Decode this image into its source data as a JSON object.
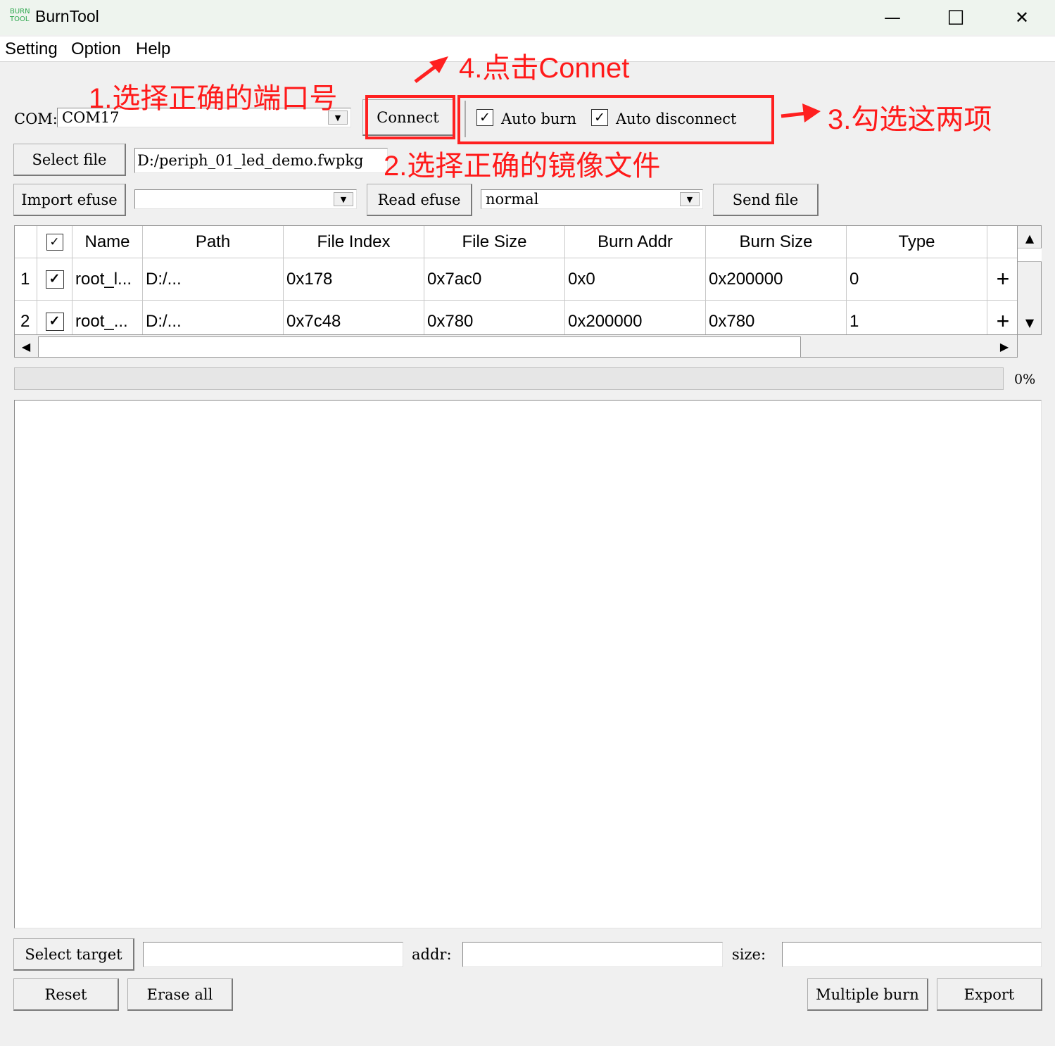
{
  "window": {
    "logo_top": "BURN",
    "logo_bottom": "TOOL",
    "title": "BurnTool",
    "minimize_glyph": "—",
    "maximize_glyph": "☐",
    "close_glyph": "✕"
  },
  "menu": [
    "Setting",
    "Option",
    "Help"
  ],
  "com": {
    "label": "COM:",
    "value": "COM17",
    "connect_label": "Connect",
    "auto_burn_label": "Auto burn",
    "auto_burn_checked": true,
    "auto_disconnect_label": "Auto disconnect",
    "auto_disconnect_checked": true
  },
  "file": {
    "select_label": "Select file",
    "path": "D:/periph_01_led_demo.fwpkg"
  },
  "efuse": {
    "import_label": "Import efuse",
    "import_value": "",
    "read_label": "Read efuse",
    "mode_value": "normal",
    "send_label": "Send file"
  },
  "table": {
    "columns": [
      "Name",
      "Path",
      "File Index",
      "File Size",
      "Burn Addr",
      "Burn Size",
      "Type"
    ],
    "rows": [
      {
        "num": "1",
        "checked": true,
        "name": "root_l...",
        "path": "D:/...",
        "file_index": "0x178",
        "file_size": "0x7ac0",
        "burn_addr": "0x0",
        "burn_size": "0x200000",
        "type": "0"
      },
      {
        "num": "2",
        "checked": true,
        "name": "root_...",
        "path": "D:/...",
        "file_index": "0x7c48",
        "file_size": "0x780",
        "burn_addr": "0x200000",
        "burn_size": "0x780",
        "type": "1"
      }
    ]
  },
  "progress": {
    "percent_text": "0%",
    "value": 0
  },
  "bottom": {
    "select_target_label": "Select target",
    "target_value": "",
    "addr_label": "addr:",
    "addr_value": "",
    "size_label": "size:",
    "size_value": "",
    "reset_label": "Reset",
    "erase_all_label": "Erase all",
    "multiple_burn_label": "Multiple burn",
    "export_label": "Export"
  },
  "annotations": {
    "step1": "1.选择正确的端口号",
    "step2": "2.选择正确的镜像文件",
    "step3": "3.勾选这两项",
    "step4": "4.点击Connet",
    "color": "#ff1a1a"
  }
}
